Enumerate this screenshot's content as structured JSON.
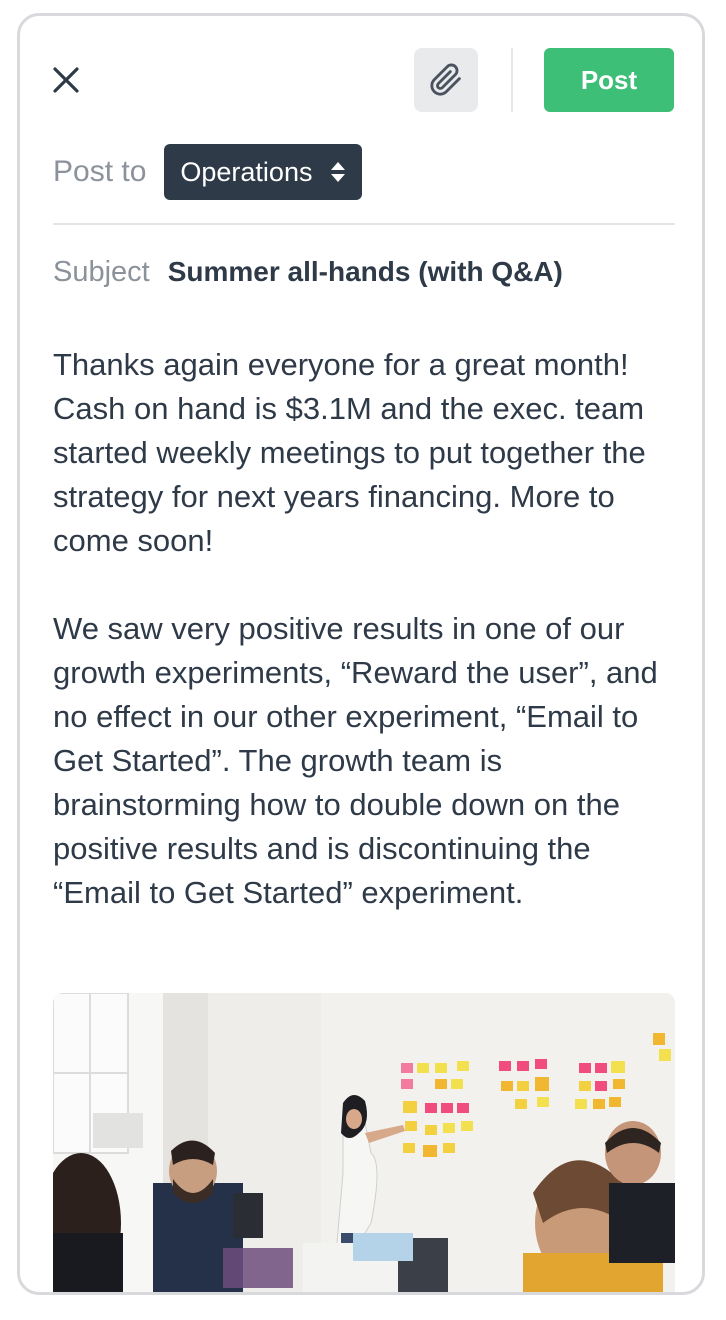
{
  "toolbar": {
    "close_icon": "close-icon",
    "attach_icon": "paperclip-icon",
    "post_label": "Post",
    "post_color": "#3dbf78"
  },
  "post_to": {
    "label": "Post to",
    "selected_channel": "Operations"
  },
  "subject": {
    "label": "Subject",
    "value": "Summer all-hands (with Q&A)"
  },
  "body": {
    "paragraphs": [
      "Thanks again everyone for a great month! Cash on hand is $3.1M and the exec. team started weekly meetings to put together the strategy for next years financing. More to come soon!",
      "We saw very positive results in one of our growth experiments, “Reward the user”, and no effect in our other experiment, “Email to Get Started”. The growth team is brainstorming how to double down on the positive results and is discontinuing the “Email to Get Started” experiment."
    ]
  },
  "colors": {
    "text": "#2f3a48",
    "muted": "#8b929a",
    "select_bg": "#2f3a48"
  }
}
